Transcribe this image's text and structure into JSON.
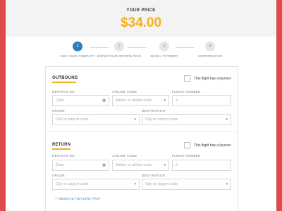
{
  "price": {
    "label": "YOUR PRICE",
    "value": "$34.00"
  },
  "steps": [
    {
      "number": "1",
      "label": "ADD YOUR ITINERARY",
      "active": true
    },
    {
      "number": "2",
      "label": "ENTER YOUR INFORMATION",
      "active": false
    },
    {
      "number": "3",
      "label": "MAKE A PAYMENT",
      "active": false
    },
    {
      "number": "4",
      "label": "CONFIRMATION",
      "active": false
    }
  ],
  "outbound": {
    "title": "OUTBOUND",
    "layover_label": "This flight has a layover",
    "departs_on_label": "DEPARTS ON",
    "departs_on_placeholder": "Date",
    "airline_code_label": "AIRLINE CODE",
    "airline_code_placeholder": "Airline or airline code",
    "flight_number_label": "FLIGHT NUMBER",
    "flight_number_placeholder": "#",
    "origin_label": "ORIGIN",
    "origin_placeholder": "City or airport code",
    "destination_label": "DESTINATION",
    "destination_placeholder": "City or airport code"
  },
  "return": {
    "title": "RETURN",
    "layover_label": "This flight has a layover",
    "departs_on_label": "DEPARTS ON",
    "departs_on_placeholder": "Date",
    "airline_code_label": "AIRLINE CODE",
    "airline_code_placeholder": "Airline or airline code",
    "flight_number_label": "FLIGHT NUMBER",
    "flight_number_placeholder": "#",
    "origin_label": "ORIGIN",
    "origin_placeholder": "City or airport code",
    "destination_label": "DESTINATION",
    "destination_placeholder": "City or airport code"
  },
  "remove_return_label": "+ REMOVE RETURN TRIP",
  "icons": {
    "calendar": "calendar-icon",
    "dropdown": "chevron-down-icon"
  },
  "colors": {
    "accent": "#f4b21a",
    "primary": "#2d7fc1",
    "background": "#e04a4a"
  }
}
